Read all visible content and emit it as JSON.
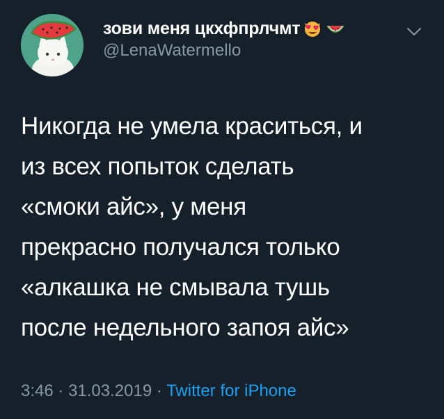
{
  "tweet": {
    "display_name": "зови меня цкхфпрлчмт",
    "name_emojis": [
      "smiling-cat-heart-eyes-icon",
      "watermelon-icon"
    ],
    "handle": "@LenaWatermello",
    "text": "Никогда не умела краситься, и\nиз всех попыток сделать\n«смоки айс», у меня\nпрекрасно получался только\n«алкашка не смывала тушь\nпосле недельного запоя айс»",
    "time": "3:46",
    "separator": "·",
    "date": "31.03.2019",
    "source": "Twitter for iPhone"
  },
  "icons": {
    "menu": "chevron-down-icon",
    "avatar": "avatar-white-cat-with-watermelon"
  },
  "colors": {
    "background": "#15202b",
    "text_primary": "#ffffff",
    "text_secondary": "#8899a6",
    "link": "#1da1f2"
  }
}
